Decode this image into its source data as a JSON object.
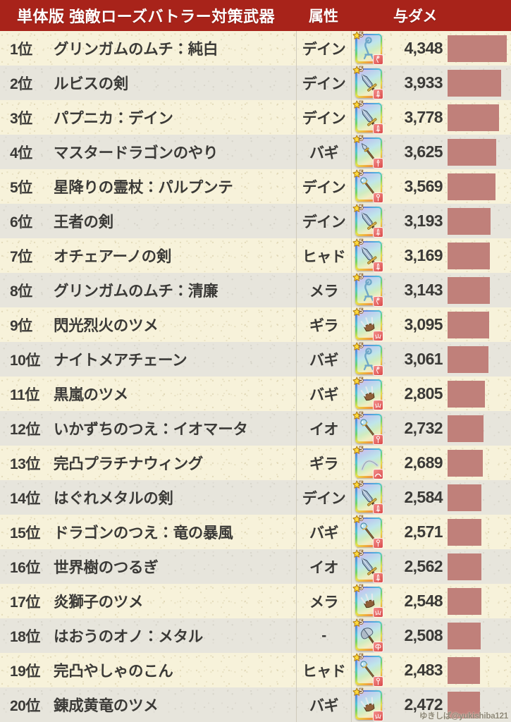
{
  "header": {
    "title": "単体版 強敵ローズバトラー対策武器",
    "attribute_label": "属性",
    "damage_label": "与ダメ",
    "background_color": "#a8231a",
    "text_color": "#ffffff"
  },
  "theme": {
    "row_odd_color": "#f7f2da",
    "row_even_color": "#e7e5dc",
    "bar_color": "#c0807a",
    "text_color": "#3b3a37",
    "divider_color": "#cfcabb"
  },
  "icon": {
    "star_rank": "5",
    "star_name": "star-rank-badge",
    "card_name": "weapon-card-icon"
  },
  "watermark": "ゆきしば@yukishiba121",
  "chart_data": {
    "type": "bar",
    "title": "単体版 強敵ローズバトラー対策武器",
    "xlabel": "与ダメ",
    "ylabel": "",
    "orientation": "horizontal",
    "categories": [
      "グリンガムのムチ：純白",
      "ルビスの剣",
      "パプニカ：デイン",
      "マスタードラゴンのやり",
      "星降りの霊杖：パルプンテ",
      "王者の剣",
      "オチェアーノの剣",
      "グリンガムのムチ：清廉",
      "閃光烈火のツメ",
      "ナイトメアチェーン",
      "黒嵐のツメ",
      "いかずちのつえ：イオマータ",
      "完凸プラチナウィング",
      "はぐれメタルの剣",
      "ドラゴンのつえ：竜の暴風",
      "世界樹のつるぎ",
      "炎獅子のツメ",
      "はおうのオノ：メタル",
      "完凸やしゃのこん",
      "錬成黄竜のツメ"
    ],
    "values": [
      4348,
      3933,
      3778,
      3625,
      3569,
      3193,
      3169,
      3143,
      3095,
      3061,
      2805,
      2732,
      2689,
      2584,
      2571,
      2562,
      2548,
      2508,
      2483,
      2472
    ],
    "xlim": [
      0,
      4348
    ],
    "grid": false,
    "legend": null
  },
  "rows": [
    {
      "rank": "1位",
      "name": "グリンガムのムチ：純白",
      "attribute": "デイン",
      "damage": "4,348",
      "damage_value": 4348,
      "weapon_type": "whip"
    },
    {
      "rank": "2位",
      "name": "ルビスの剣",
      "attribute": "デイン",
      "damage": "3,933",
      "damage_value": 3933,
      "weapon_type": "sword"
    },
    {
      "rank": "3位",
      "name": "パプニカ：デイン",
      "attribute": "デイン",
      "damage": "3,778",
      "damage_value": 3778,
      "weapon_type": "sword"
    },
    {
      "rank": "4位",
      "name": "マスタードラゴンのやり",
      "attribute": "バギ",
      "damage": "3,625",
      "damage_value": 3625,
      "weapon_type": "spear"
    },
    {
      "rank": "5位",
      "name": "星降りの霊杖：パルプンテ",
      "attribute": "デイン",
      "damage": "3,569",
      "damage_value": 3569,
      "weapon_type": "staff"
    },
    {
      "rank": "6位",
      "name": "王者の剣",
      "attribute": "デイン",
      "damage": "3,193",
      "damage_value": 3193,
      "weapon_type": "sword"
    },
    {
      "rank": "7位",
      "name": "オチェアーノの剣",
      "attribute": "ヒャド",
      "damage": "3,169",
      "damage_value": 3169,
      "weapon_type": "sword"
    },
    {
      "rank": "8位",
      "name": "グリンガムのムチ：清廉",
      "attribute": "メラ",
      "damage": "3,143",
      "damage_value": 3143,
      "weapon_type": "whip"
    },
    {
      "rank": "9位",
      "name": "閃光烈火のツメ",
      "attribute": "ギラ",
      "damage": "3,095",
      "damage_value": 3095,
      "weapon_type": "claw"
    },
    {
      "rank": "10位",
      "name": "ナイトメアチェーン",
      "attribute": "バギ",
      "damage": "3,061",
      "damage_value": 3061,
      "weapon_type": "whip"
    },
    {
      "rank": "11位",
      "name": "黒嵐のツメ",
      "attribute": "バギ",
      "damage": "2,805",
      "damage_value": 2805,
      "weapon_type": "claw"
    },
    {
      "rank": "12位",
      "name": "いかずちのつえ：イオマータ",
      "attribute": "イオ",
      "damage": "2,732",
      "damage_value": 2732,
      "weapon_type": "staff"
    },
    {
      "rank": "13位",
      "name": "完凸プラチナウィング",
      "attribute": "ギラ",
      "damage": "2,689",
      "damage_value": 2689,
      "weapon_type": "boomerang"
    },
    {
      "rank": "14位",
      "name": "はぐれメタルの剣",
      "attribute": "デイン",
      "damage": "2,584",
      "damage_value": 2584,
      "weapon_type": "sword"
    },
    {
      "rank": "15位",
      "name": "ドラゴンのつえ：竜の暴風",
      "attribute": "バギ",
      "damage": "2,571",
      "damage_value": 2571,
      "weapon_type": "staff"
    },
    {
      "rank": "16位",
      "name": "世界樹のつるぎ",
      "attribute": "イオ",
      "damage": "2,562",
      "damage_value": 2562,
      "weapon_type": "sword"
    },
    {
      "rank": "17位",
      "name": "炎獅子のツメ",
      "attribute": "メラ",
      "damage": "2,548",
      "damage_value": 2548,
      "weapon_type": "claw"
    },
    {
      "rank": "18位",
      "name": "はおうのオノ：メタル",
      "attribute": "-",
      "damage": "2,508",
      "damage_value": 2508,
      "weapon_type": "axe"
    },
    {
      "rank": "19位",
      "name": "完凸やしゃのこん",
      "attribute": "ヒャド",
      "damage": "2,483",
      "damage_value": 2483,
      "weapon_type": "staff"
    },
    {
      "rank": "20位",
      "name": "錬成黄竜のツメ",
      "attribute": "バギ",
      "damage": "2,472",
      "damage_value": 2472,
      "weapon_type": "claw"
    }
  ]
}
